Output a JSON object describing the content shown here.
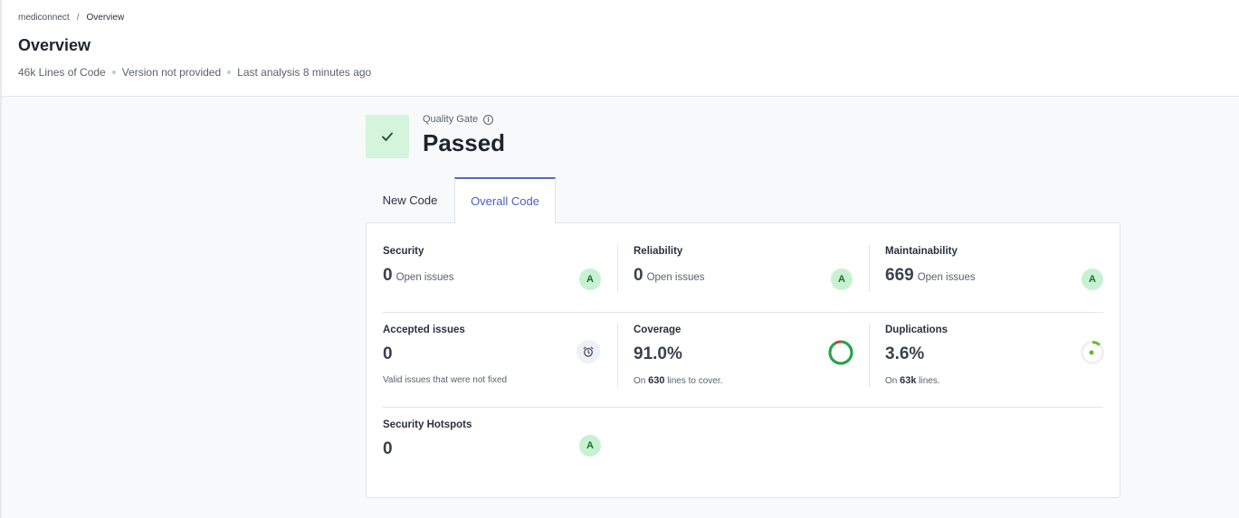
{
  "breadcrumb": {
    "project": "mediconnect",
    "separator": "/",
    "current": "Overview"
  },
  "page": {
    "title": "Overview",
    "lines_of_code": "46k Lines of Code",
    "version": "Version not provided",
    "last_analysis": "Last analysis 8 minutes ago"
  },
  "quality_gate": {
    "label": "Quality Gate",
    "status": "Passed",
    "info_icon": "i",
    "icon": "check-icon"
  },
  "tabs": [
    {
      "label": "New Code",
      "active": false
    },
    {
      "label": "Overall Code",
      "active": true
    }
  ],
  "metrics": {
    "security": {
      "title": "Security",
      "value": "0",
      "unit": "Open issues",
      "grade": "A"
    },
    "reliability": {
      "title": "Reliability",
      "value": "0",
      "unit": "Open issues",
      "grade": "A"
    },
    "maintainability": {
      "title": "Maintainability",
      "value": "669",
      "unit": "Open issues",
      "grade": "A"
    },
    "accepted_issues": {
      "title": "Accepted issues",
      "value": "0",
      "sub": "Valid issues that were not fixed",
      "icon": "alarm-clock-icon"
    },
    "coverage": {
      "title": "Coverage",
      "value": "91.0%",
      "sub_prefix": "On",
      "sub_value": "630",
      "sub_suffix": "lines to cover.",
      "percent": 91.0
    },
    "duplications": {
      "title": "Duplications",
      "value": "3.6%",
      "sub_prefix": "On",
      "sub_value": "63k",
      "sub_suffix": "lines.",
      "percent": 3.6
    },
    "security_hotspots": {
      "title": "Security Hotspots",
      "value": "0",
      "grade": "A"
    }
  },
  "colors": {
    "accent": "#5468c8",
    "grade_a_bg": "#c7f2d2",
    "grade_a_text": "#1b6b34",
    "coverage_good": "#1ea84b",
    "coverage_missing": "#d23a3a",
    "duplication_fill": "#6ab82e",
    "gate_passed_bg": "#d4f5dc"
  }
}
